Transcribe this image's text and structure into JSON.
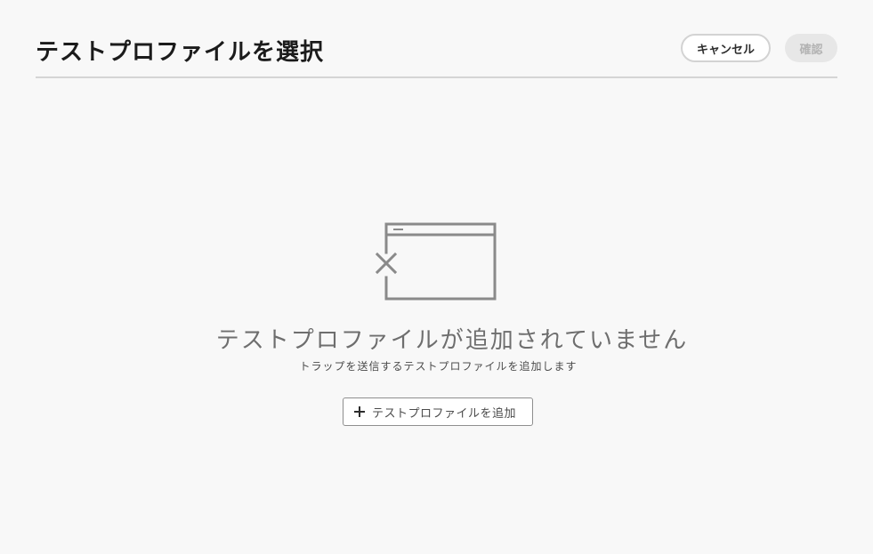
{
  "dialog": {
    "title": "テストプロファイルを選択",
    "cancel_label": "キャンセル",
    "confirm_label": "確認"
  },
  "empty_state": {
    "illustration_icon": "window-x-icon",
    "heading": "テストプロファイルが追加されていません",
    "description": "トラップを送信するテストプロファイルを追加します",
    "add_button_icon": "plus-icon",
    "add_button_label": "テストプロファイルを追加"
  }
}
